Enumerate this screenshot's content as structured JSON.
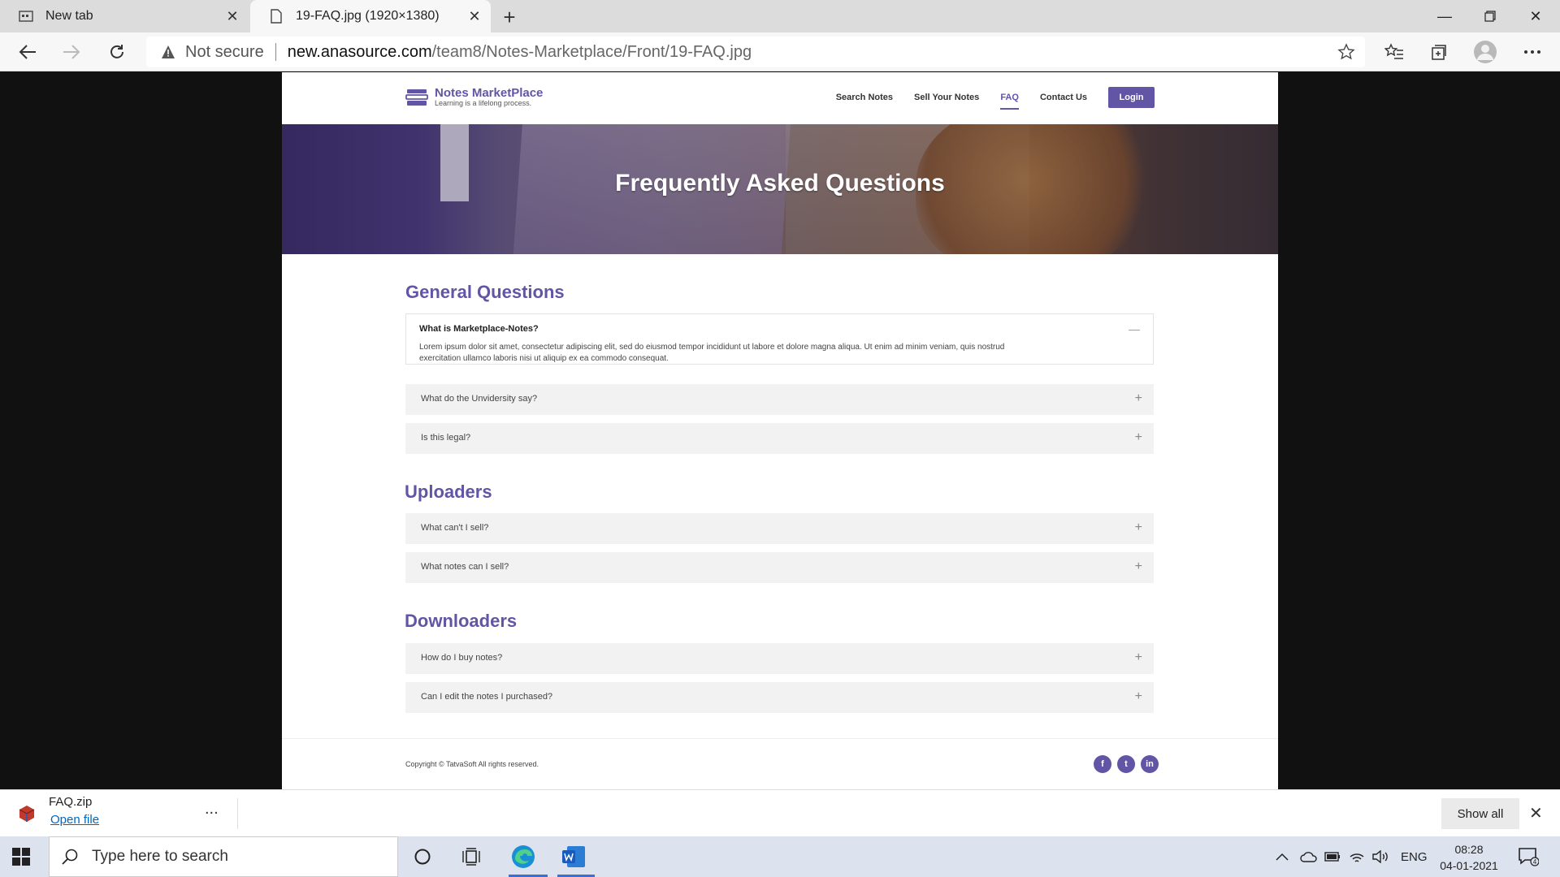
{
  "browser": {
    "tabs": [
      {
        "label": "New tab",
        "icon": "newtab-icon"
      },
      {
        "label": "19-FAQ.jpg (1920×1380)",
        "icon": "file-icon"
      }
    ],
    "address": {
      "security": "Not secure",
      "host": "new.anasource.com",
      "path": "/team8/Notes-Marketplace/Front/19-FAQ.jpg"
    }
  },
  "site": {
    "logo": {
      "name": "Notes MarketPlace",
      "tagline": "Learning is a lifelong process."
    },
    "nav": [
      {
        "label": "Search Notes"
      },
      {
        "label": "Sell Your Notes"
      },
      {
        "label": "FAQ",
        "active": true
      },
      {
        "label": "Contact Us"
      }
    ],
    "login": "Login",
    "hero_title": "Frequently Asked Questions",
    "sections": [
      {
        "title": "General Questions",
        "items": [
          {
            "q": "What is Marketplace-Notes?",
            "a": "Lorem ipsum dolor sit amet, consectetur adipiscing elit, sed do eiusmod tempor incididunt ut labore et dolore magna aliqua. Ut enim ad minim veniam, quis nostrud exercitation ullamco laboris nisi ut aliquip ex ea commodo consequat.",
            "open": true
          },
          {
            "q": "What do the Unvidersity say?"
          },
          {
            "q": "Is this legal?"
          }
        ]
      },
      {
        "title": "Uploaders",
        "items": [
          {
            "q": "What can't I sell?"
          },
          {
            "q": "What notes can I sell?"
          }
        ]
      },
      {
        "title": "Downloaders",
        "items": [
          {
            "q": "How do I buy notes?"
          },
          {
            "q": "Can I edit the notes I purchased?"
          }
        ]
      }
    ],
    "toggle_open": "—",
    "toggle_closed": "+",
    "copyright": "Copyright © TatvaSoft All rights reserved.",
    "socials": [
      "f",
      "t",
      "in"
    ],
    "accent": "#6255a5"
  },
  "download": {
    "file": "FAQ.zip",
    "open": "Open file",
    "more": "...",
    "show_all": "Show all"
  },
  "taskbar": {
    "search_placeholder": "Type here to search",
    "lang": "ENG",
    "time": "08:28",
    "date": "04-01-2021",
    "notifications": "4"
  }
}
